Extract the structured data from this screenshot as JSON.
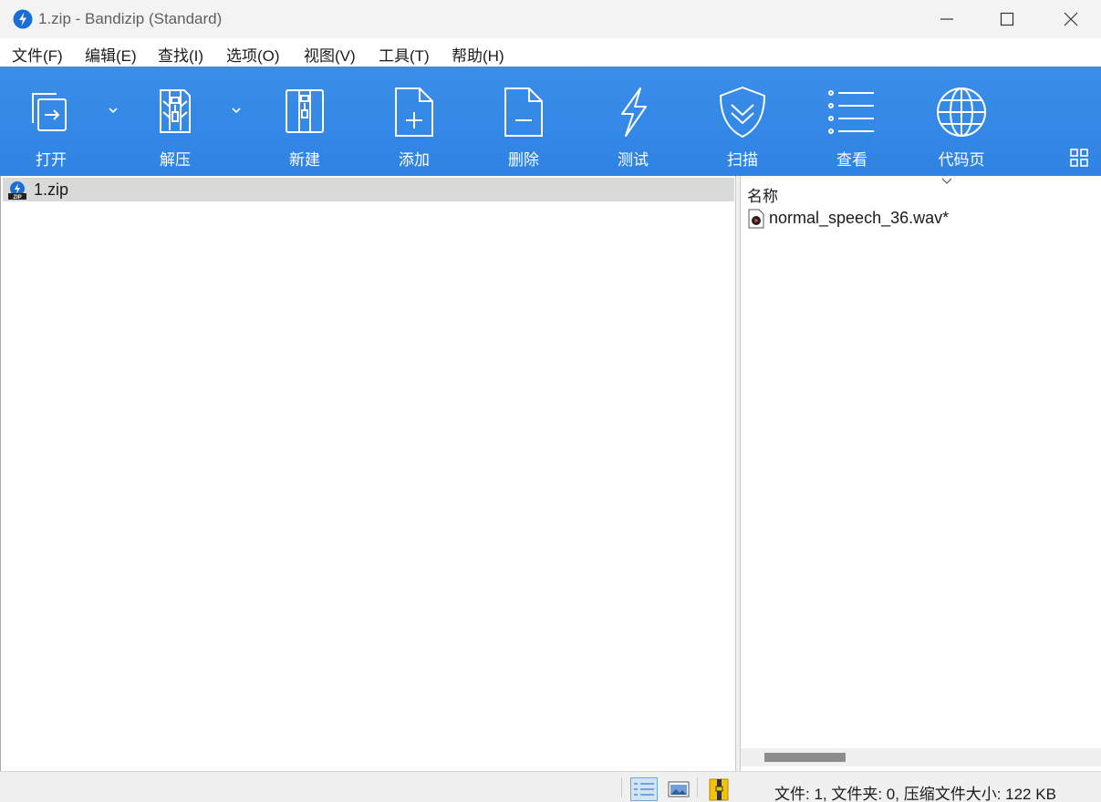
{
  "window": {
    "title": "1.zip - Bandizip (Standard)"
  },
  "menu": {
    "items": [
      {
        "label": "文件(F)"
      },
      {
        "label": "编辑(E)"
      },
      {
        "label": "查找(I)"
      },
      {
        "label": "选项(O)"
      },
      {
        "label": "视图(V)"
      },
      {
        "label": "工具(T)"
      },
      {
        "label": "帮助(H)"
      }
    ]
  },
  "toolbar": {
    "buttons": [
      {
        "label": "打开",
        "icon": "open-icon"
      },
      {
        "label": "解压",
        "icon": "extract-icon"
      },
      {
        "label": "新建",
        "icon": "new-archive-icon"
      },
      {
        "label": "添加",
        "icon": "add-file-icon"
      },
      {
        "label": "删除",
        "icon": "delete-file-icon"
      },
      {
        "label": "测试",
        "icon": "test-lightning-icon"
      },
      {
        "label": "扫描",
        "icon": "scan-shield-icon"
      },
      {
        "label": "查看",
        "icon": "view-list-icon"
      },
      {
        "label": "代码页",
        "icon": "codepage-globe-icon"
      }
    ],
    "accent_color": "#2e83e4"
  },
  "tree": {
    "items": [
      {
        "label": "1.zip",
        "icon": "zip-archive-icon"
      }
    ]
  },
  "filelist": {
    "column_name": "名称",
    "files": [
      {
        "name": "normal_speech_36.wav*",
        "icon": "audio-file-icon"
      }
    ]
  },
  "status": {
    "text": "文件: 1, 文件夹: 0, 压缩文件大小: 122 KB"
  }
}
